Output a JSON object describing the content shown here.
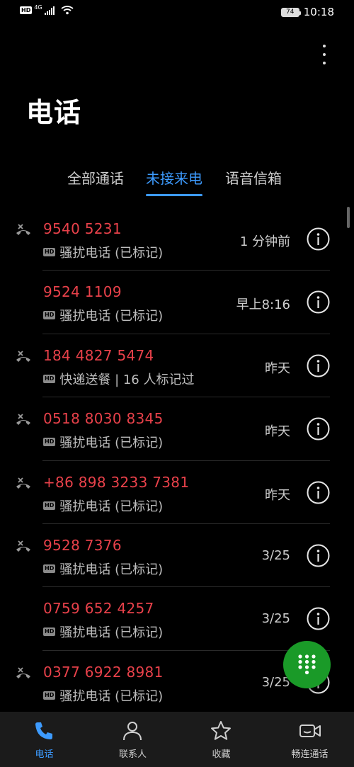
{
  "status_bar": {
    "network_badge": "HD",
    "network_type": "4G",
    "battery": "74",
    "time": "10:18"
  },
  "header": {
    "title": "电话"
  },
  "tabs": [
    {
      "label": "全部通话",
      "active": false
    },
    {
      "label": "未接来电",
      "active": true
    },
    {
      "label": "语音信箱",
      "active": false
    }
  ],
  "calls": [
    {
      "number": "9540 5231",
      "tag": "HD",
      "label": "骚扰电话 (已标记)",
      "time": "1 分钟前",
      "missed_icon": true
    },
    {
      "number": "9524 1109",
      "tag": "HD",
      "label": "骚扰电话 (已标记)",
      "time": "早上8:16",
      "missed_icon": false
    },
    {
      "number": "184 4827 5474",
      "tag": "HD",
      "label": "快递送餐 | 16 人标记过",
      "time": "昨天",
      "missed_icon": true
    },
    {
      "number": "0518 8030 8345",
      "tag": "HD",
      "label": "骚扰电话 (已标记)",
      "time": "昨天",
      "missed_icon": true
    },
    {
      "number": "+86 898 3233 7381",
      "tag": "HD",
      "label": "骚扰电话 (已标记)",
      "time": "昨天",
      "missed_icon": true
    },
    {
      "number": "9528 7376",
      "tag": "HD",
      "label": "骚扰电话 (已标记)",
      "time": "3/25",
      "missed_icon": true
    },
    {
      "number": "0759 652 4257",
      "tag": "HD",
      "label": "骚扰电话 (已标记)",
      "time": "3/25",
      "missed_icon": false
    },
    {
      "number": "0377 6922 8981",
      "tag": "HD",
      "label": "骚扰电话 (已标记)",
      "time": "3/25",
      "missed_icon": true
    }
  ],
  "bottom_nav": [
    {
      "label": "电话",
      "icon": "phone-icon",
      "active": true
    },
    {
      "label": "联系人",
      "icon": "contacts-icon",
      "active": false
    },
    {
      "label": "收藏",
      "icon": "star-icon",
      "active": false
    },
    {
      "label": "畅连通话",
      "icon": "video-call-icon",
      "active": false
    }
  ],
  "colors": {
    "accent": "#3d9bff",
    "missed": "#e8414a",
    "fab": "#1a9a28",
    "background": "#000000"
  }
}
